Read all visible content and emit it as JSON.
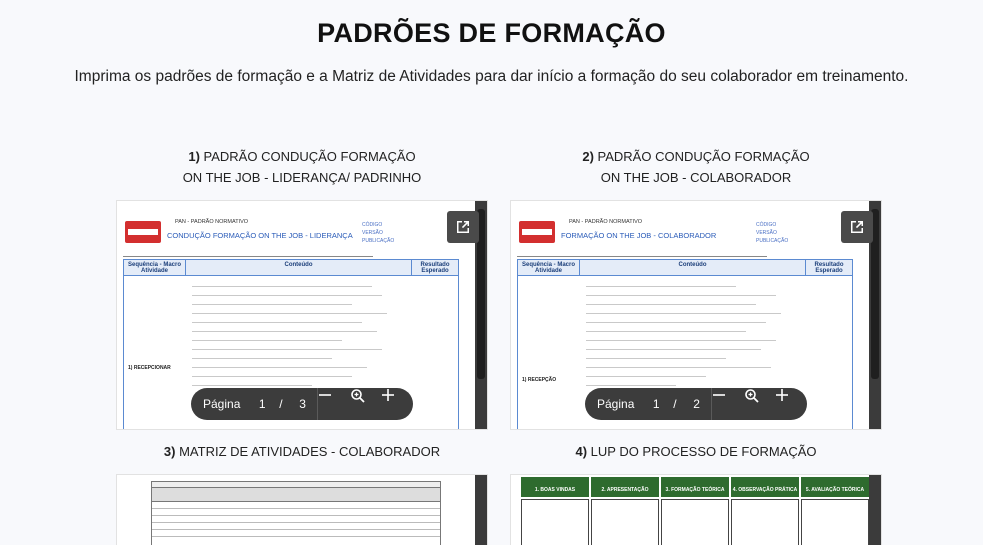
{
  "page": {
    "title": "PADRÕES DE FORMAÇÃO",
    "subtitle": "Imprima os padrões de formação e a Matriz de Atividades para dar início a formação do seu colaborador em treinamento."
  },
  "cards": [
    {
      "number": "1)",
      "line1": "PADRÃO CONDUÇÃO FORMAÇÃO",
      "line2": "ON THE JOB - LIDERANÇA/ PADRINHO",
      "doc_meta": "PAN - PADRÃO NORMATIVO",
      "doc_heading": "CONDUÇÃO FORMAÇÃO ON THE JOB - LIDERANÇA",
      "doc_side": [
        "CÓDIGO",
        "VERSÃO",
        "PUBLICAÇÃO"
      ],
      "col1": "Sequência - Macro Atividade",
      "col2": "Conteúdo",
      "col3": "Resultado Esperado",
      "row_label": "1)     RECEPCIONAR",
      "toolbar": {
        "label": "Página",
        "page": "1",
        "slash": "/",
        "total": "3"
      }
    },
    {
      "number": "2)",
      "line1": "PADRÃO CONDUÇÃO FORMAÇÃO",
      "line2": "ON THE JOB - COLABORADOR",
      "doc_meta": "PAN - PADRÃO NORMATIVO",
      "doc_heading": "FORMAÇÃO ON THE JOB - COLABORADOR",
      "doc_side": [
        "CÓDIGO",
        "VERSÃO",
        "PUBLICAÇÃO"
      ],
      "col1": "Sequência - Macro Atividade",
      "col2": "Conteúdo",
      "col3": "Resultado Esperado",
      "row_label": "1)     RECEPÇÃO",
      "toolbar": {
        "label": "Página",
        "page": "1",
        "slash": "/",
        "total": "2"
      }
    },
    {
      "number": "3)",
      "line1": "MATRIZ DE ATIVIDADES - COLABORADOR"
    },
    {
      "number": "4)",
      "line1": "LUP DO PROCESSO DE FORMAÇÃO",
      "lup_columns": [
        "1. BOAS VINDAS",
        "2. APRESENTAÇÃO",
        "3. FORMAÇÃO TEÓRICA",
        "4. OBSERVAÇÃO PRÁTICA",
        "5. AVALIAÇÃO TEÓRICA"
      ]
    }
  ],
  "colors": {
    "doc_blue": "#2a5bb8",
    "logo_red": "#d32f2f",
    "lup_green": "#2e6b2e",
    "toolbar_bg": "#3c3c3c"
  },
  "icons": [
    "popout-icon",
    "minus-icon",
    "zoom-icon",
    "plus-icon"
  ]
}
